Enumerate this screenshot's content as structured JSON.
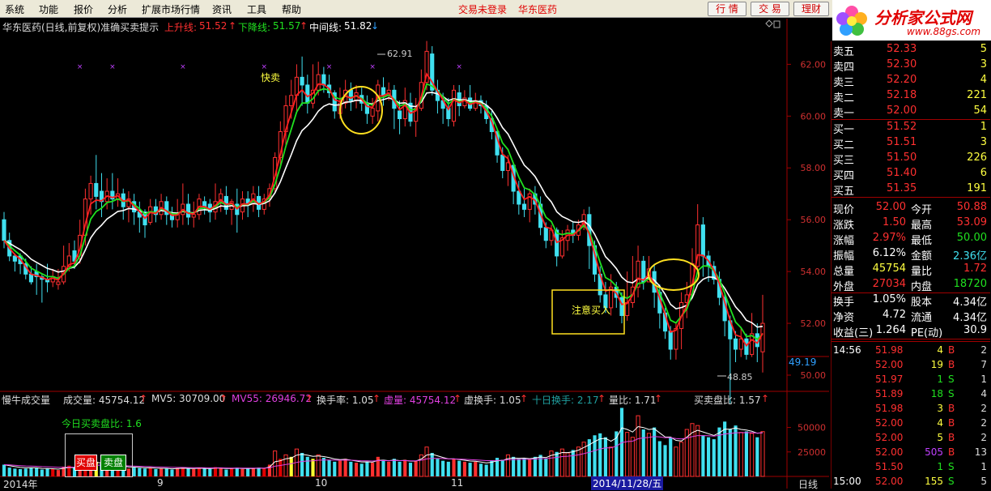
{
  "menu": {
    "items": [
      "系统",
      "功能",
      "报价",
      "分析",
      "扩展市场行情",
      "资讯",
      "工具",
      "帮助"
    ],
    "status_trade": "交易未登录",
    "status_stock": "华东医药",
    "buttons": [
      "行 情",
      "交 易",
      "理财"
    ]
  },
  "logo": {
    "text": "分析家公式网",
    "url": "www.88gs.com",
    "color": "#e00000"
  },
  "header": {
    "name": "华东医药(日线,前复权)准确买卖提示",
    "up_label": "上升线:",
    "up_value": "51.52",
    "up_arrow": "↑",
    "down_label": "下降线:",
    "down_value": "51.57",
    "down_arrow": "↑",
    "mid_label": "中间线:",
    "mid_value": "51.82",
    "mid_arrow": "↓"
  },
  "annotations": {
    "sell": "快卖",
    "buy": "注意买入",
    "high": "62.91",
    "low": "48.85"
  },
  "price_axis": {
    "ticks": [
      "62.00",
      "60.00",
      "58.00",
      "56.00",
      "54.00",
      "52.00",
      "50.00"
    ],
    "current": "49.19"
  },
  "volume_axis": {
    "ticks": [
      "50000",
      "25000"
    ]
  },
  "date_axis": {
    "labels": [
      "2014年",
      "9",
      "10",
      "11",
      "2014/11/28/五"
    ],
    "period": "日线"
  },
  "volume_header": {
    "title": "慢牛成交量",
    "vol_label": "成交量: 45754.12",
    "mv5_label": "MV5: 30709.00",
    "mv55_label": "MV55: 26946.72",
    "turnover_label": "换手率: 1.05",
    "vvol_label": "虚量: 45754.12",
    "vturn_label": "虚换手: 1.05",
    "ten_label": "十日换手: 2.17",
    "ratio_label": "量比: 1.71",
    "bs_label": "买卖盘比: 1.57",
    "arrow": "↑",
    "today_ratio": "今日买卖盘比: 1.6",
    "buy_btn": "买盘",
    "sell_btn": "卖盘"
  },
  "orderbook": {
    "sells": [
      [
        "卖五",
        "52.33",
        "5"
      ],
      [
        "卖四",
        "52.30",
        "3"
      ],
      [
        "卖三",
        "52.20",
        "4"
      ],
      [
        "卖二",
        "52.18",
        "221"
      ],
      [
        "卖一",
        "52.00",
        "54"
      ]
    ],
    "buys": [
      [
        "买一",
        "51.52",
        "1"
      ],
      [
        "买二",
        "51.51",
        "3"
      ],
      [
        "买三",
        "51.50",
        "226"
      ],
      [
        "买四",
        "51.40",
        "6"
      ],
      [
        "买五",
        "51.35",
        "191"
      ]
    ]
  },
  "stats": [
    [
      "现价",
      "52.00",
      "今开",
      "50.88"
    ],
    [
      "涨跌",
      "1.50",
      "最高",
      "53.09"
    ],
    [
      "涨幅",
      "2.97%",
      "最低",
      "50.00"
    ],
    [
      "振幅",
      "6.12%",
      "金额",
      "2.36亿"
    ],
    [
      "总量",
      "45754",
      "量比",
      "1.72"
    ],
    [
      "外盘",
      "27034",
      "内盘",
      "18720"
    ],
    [
      "换手",
      "1.05%",
      "股本",
      "4.34亿"
    ],
    [
      "净资",
      "4.72",
      "流通",
      "4.34亿"
    ],
    [
      "收益(三)",
      "1.264",
      "PE(动)",
      "30.9"
    ]
  ],
  "ticks": [
    [
      "14:56",
      "51.98",
      "4",
      "B",
      "2"
    ],
    [
      "",
      "52.00",
      "19",
      "B",
      "7"
    ],
    [
      "",
      "51.97",
      "1",
      "S",
      "1"
    ],
    [
      "",
      "51.89",
      "18",
      "S",
      "4"
    ],
    [
      "",
      "51.98",
      "3",
      "B",
      "2"
    ],
    [
      "",
      "52.00",
      "4",
      "B",
      "2"
    ],
    [
      "",
      "52.00",
      "5",
      "B",
      "2"
    ],
    [
      "",
      "52.00",
      "505",
      "B",
      "13"
    ],
    [
      "",
      "51.50",
      "1",
      "S",
      "1"
    ],
    [
      "15:00",
      "52.00",
      "155",
      "S",
      "5"
    ]
  ],
  "chart_data": {
    "type": "candlestick",
    "price_range": [
      50,
      63.2
    ],
    "volume_range": [
      0,
      72000
    ],
    "candles": [
      [
        56.0,
        55.2,
        56.3,
        54.9
      ],
      [
        55.2,
        54.6,
        55.5,
        54.4
      ],
      [
        54.6,
        54.4,
        54.7,
        54.0
      ],
      [
        54.6,
        54.3,
        54.7,
        53.9
      ],
      [
        54.3,
        53.9,
        54.5,
        53.7
      ],
      [
        53.9,
        53.6,
        54.2,
        53.5
      ],
      [
        54.0,
        53.8,
        54.3,
        53.1
      ],
      [
        53.8,
        53.7,
        53.9,
        52.8
      ],
      [
        53.7,
        53.6,
        54.3,
        53.2
      ],
      [
        53.6,
        53.8,
        54.1,
        53.4
      ],
      [
        53.5,
        53.6,
        54.1,
        53.3
      ],
      [
        53.6,
        54.2,
        55.0,
        53.5
      ],
      [
        54.2,
        54.6,
        55.1,
        54.0
      ],
      [
        54.8,
        54.4,
        55.2,
        54.1
      ],
      [
        54.5,
        55.4,
        56.0,
        54.3
      ],
      [
        55.4,
        56.8,
        57.2,
        55.0
      ],
      [
        56.8,
        57.4,
        57.7,
        56.2
      ],
      [
        57.4,
        56.9,
        58.5,
        56.4
      ],
      [
        57.1,
        56.7,
        57.8,
        56.1
      ],
      [
        56.7,
        57.1,
        57.6,
        56.4
      ],
      [
        57.1,
        56.8,
        57.8,
        56.4
      ],
      [
        56.8,
        57.0,
        57.6,
        56.5
      ],
      [
        57.0,
        56.5,
        57.2,
        56.0
      ],
      [
        56.5,
        56.8,
        57.1,
        55.9
      ],
      [
        56.7,
        56.3,
        57.0,
        55.8
      ],
      [
        56.3,
        56.1,
        56.7,
        55.5
      ],
      [
        56.3,
        55.8,
        56.4,
        55.3
      ],
      [
        55.9,
        56.5,
        56.8,
        55.8
      ],
      [
        56.5,
        56.2,
        56.8,
        55.9
      ],
      [
        56.2,
        56.7,
        57.0,
        56.0
      ],
      [
        56.7,
        56.2,
        56.9,
        55.8
      ],
      [
        56.2,
        56.0,
        56.5,
        55.7
      ],
      [
        56.0,
        56.2,
        56.8,
        55.7
      ],
      [
        56.2,
        56.6,
        57.4,
        55.8
      ],
      [
        56.6,
        56.1,
        57.0,
        55.8
      ],
      [
        56.1,
        56.2,
        56.7,
        55.7
      ],
      [
        56.2,
        56.8,
        57.0,
        56.0
      ],
      [
        56.7,
        56.5,
        56.9,
        56.2
      ],
      [
        56.6,
        56.3,
        56.8,
        55.9
      ],
      [
        56.3,
        56.7,
        57.4,
        56.0
      ],
      [
        56.7,
        57.0,
        57.2,
        56.3
      ],
      [
        56.9,
        56.4,
        57.3,
        56.2
      ],
      [
        56.4,
        56.7,
        56.8,
        55.8
      ],
      [
        56.6,
        56.2,
        57.2,
        55.5
      ],
      [
        56.3,
        56.8,
        57.1,
        56.0
      ],
      [
        56.8,
        56.6,
        57.1,
        56.1
      ],
      [
        56.6,
        57.0,
        57.3,
        56.3
      ],
      [
        56.9,
        56.4,
        57.3,
        56.1
      ],
      [
        56.4,
        56.8,
        57.0,
        56.2
      ],
      [
        56.8,
        57.2,
        57.4,
        56.5
      ],
      [
        57.2,
        58.4,
        58.6,
        57.0
      ],
      [
        58.4,
        59.4,
        59.8,
        58.0
      ],
      [
        59.4,
        60.4,
        60.8,
        58.8
      ],
      [
        60.4,
        60.8,
        61.4,
        59.9
      ],
      [
        60.8,
        61.5,
        62.0,
        60.2
      ],
      [
        61.5,
        61.2,
        62.3,
        60.4
      ],
      [
        61.2,
        60.5,
        61.6,
        60.1
      ],
      [
        60.5,
        61.0,
        62.0,
        60.3
      ],
      [
        61.0,
        61.6,
        62.1,
        60.8
      ],
      [
        61.6,
        61.2,
        61.9,
        60.9
      ],
      [
        61.2,
        60.9,
        61.6,
        60.7
      ],
      [
        60.9,
        60.2,
        61.0,
        59.9
      ],
      [
        60.1,
        60.5,
        61.1,
        59.9
      ],
      [
        60.5,
        61.0,
        61.4,
        60.3
      ],
      [
        61.0,
        60.6,
        61.3,
        60.2
      ],
      [
        60.6,
        60.9,
        61.2,
        60.3
      ],
      [
        60.8,
        60.5,
        61.1,
        60.2
      ],
      [
        60.5,
        60.1,
        60.8,
        59.7
      ],
      [
        60.0,
        60.3,
        60.7,
        59.7
      ],
      [
        60.2,
        61.2,
        61.4,
        59.8
      ],
      [
        61.1,
        60.8,
        61.5,
        60.4
      ],
      [
        60.8,
        61.0,
        61.3,
        60.6
      ],
      [
        61.0,
        60.3,
        61.2,
        59.5
      ],
      [
        60.2,
        59.9,
        60.6,
        59.3
      ],
      [
        59.9,
        60.6,
        61.1,
        59.6
      ],
      [
        60.5,
        59.8,
        60.9,
        59.6
      ],
      [
        59.8,
        60.3,
        60.7,
        59.2
      ],
      [
        60.3,
        61.3,
        61.8,
        60.2
      ],
      [
        61.3,
        62.5,
        62.9,
        61.0
      ],
      [
        62.4,
        61.0,
        62.7,
        60.8
      ],
      [
        61.0,
        60.6,
        61.4,
        60.1
      ],
      [
        60.6,
        60.3,
        60.9,
        59.7
      ],
      [
        60.3,
        59.9,
        60.7,
        59.6
      ],
      [
        59.8,
        61.0,
        61.2,
        59.6
      ],
      [
        60.9,
        60.4,
        61.2,
        60.0
      ],
      [
        60.4,
        60.7,
        61.0,
        60.3
      ],
      [
        60.7,
        60.3,
        61.2,
        60.2
      ],
      [
        60.3,
        60.6,
        60.9,
        60.2
      ],
      [
        60.6,
        60.4,
        60.8,
        60.1
      ],
      [
        60.4,
        59.9,
        60.6,
        59.7
      ],
      [
        59.9,
        59.4,
        60.2,
        59.1
      ],
      [
        59.4,
        58.5,
        59.5,
        58.2
      ],
      [
        58.5,
        57.9,
        58.8,
        57.6
      ],
      [
        57.9,
        58.2,
        58.5,
        57.3
      ],
      [
        58.1,
        57.1,
        58.2,
        56.6
      ],
      [
        57.1,
        56.6,
        57.5,
        56.2
      ],
      [
        56.6,
        56.4,
        57.2,
        56.1
      ],
      [
        56.4,
        57.0,
        57.2,
        55.9
      ],
      [
        57.0,
        56.6,
        57.3,
        56.2
      ],
      [
        56.6,
        55.7,
        56.9,
        55.4
      ],
      [
        55.7,
        55.2,
        55.9,
        54.9
      ],
      [
        55.2,
        55.6,
        55.8,
        55.0
      ],
      [
        55.6,
        54.6,
        55.7,
        54.2
      ],
      [
        54.6,
        55.3,
        55.6,
        54.5
      ],
      [
        55.2,
        55.6,
        55.8,
        54.8
      ],
      [
        55.6,
        55.4,
        55.9,
        55.1
      ],
      [
        55.4,
        55.8,
        56.0,
        55.2
      ],
      [
        55.8,
        56.2,
        56.4,
        55.6
      ],
      [
        56.2,
        55.0,
        56.5,
        54.1
      ],
      [
        55.0,
        53.9,
        55.2,
        53.6
      ],
      [
        53.9,
        53.1,
        54.2,
        52.8
      ],
      [
        53.1,
        52.6,
        53.6,
        52.4
      ],
      [
        52.6,
        53.4,
        53.9,
        52.3
      ],
      [
        53.4,
        53.0,
        53.6,
        52.6
      ],
      [
        53.0,
        52.3,
        53.2,
        52.0
      ],
      [
        52.3,
        52.8,
        54.0,
        52.1
      ],
      [
        52.8,
        53.4,
        54.6,
        52.6
      ],
      [
        53.4,
        54.4,
        55.0,
        53.0
      ],
      [
        54.4,
        53.6,
        54.6,
        53.3
      ],
      [
        53.6,
        54.1,
        54.6,
        53.7
      ],
      [
        54.0,
        53.2,
        54.3,
        52.6
      ],
      [
        53.2,
        52.4,
        53.5,
        51.8
      ],
      [
        52.4,
        51.7,
        52.6,
        51.4
      ],
      [
        51.7,
        51.0,
        51.9,
        50.6
      ],
      [
        51.0,
        51.8,
        52.0,
        50.6
      ],
      [
        51.8,
        52.8,
        53.2,
        51.0
      ],
      [
        52.8,
        53.1,
        53.6,
        52.2
      ],
      [
        53.1,
        54.3,
        54.9,
        53.0
      ],
      [
        54.2,
        55.8,
        56.6,
        54.1
      ],
      [
        55.8,
        54.6,
        56.1,
        53.8
      ],
      [
        54.6,
        54.2,
        54.8,
        53.6
      ],
      [
        54.2,
        53.7,
        54.4,
        53.5
      ],
      [
        53.7,
        53.0,
        54.0,
        52.7
      ],
      [
        53.0,
        52.1,
        53.2,
        51.5
      ],
      [
        52.1,
        51.4,
        52.3,
        48.9
      ],
      [
        51.4,
        51.0,
        51.7,
        50.5
      ],
      [
        51.0,
        51.4,
        51.8,
        50.7
      ],
      [
        51.4,
        50.8,
        51.6,
        50.6
      ],
      [
        50.8,
        51.6,
        52.4,
        50.7
      ],
      [
        51.6,
        51.1,
        52.0,
        50.5
      ],
      [
        50.9,
        52.0,
        53.1,
        50.1
      ]
    ],
    "volume": [
      12000,
      9000,
      8000,
      7500,
      8000,
      9000,
      8500,
      7000,
      8000,
      7500,
      6500,
      10000,
      11000,
      9000,
      12000,
      18000,
      16000,
      15000,
      13000,
      11000,
      10000,
      9000,
      10000,
      8000,
      9000,
      8500,
      8000,
      9000,
      7500,
      8000,
      8000,
      7000,
      8500,
      9000,
      8000,
      7500,
      9000,
      8000,
      7500,
      9500,
      8500,
      7000,
      8000,
      9000,
      7500,
      8500,
      8000,
      9000,
      8000,
      12000,
      26000,
      18000,
      22000,
      20000,
      28000,
      24000,
      20000,
      18000,
      22000,
      19000,
      17000,
      15000,
      16000,
      18000,
      15000,
      14000,
      13000,
      15000,
      14000,
      20000,
      17000,
      15000,
      18000,
      15000,
      17000,
      14000,
      16000,
      22000,
      30000,
      24000,
      18000,
      16000,
      15000,
      18000,
      16000,
      15000,
      14000,
      15000,
      13000,
      12000,
      16000,
      19000,
      17000,
      22000,
      20000,
      18000,
      19000,
      17000,
      20000,
      22000,
      18000,
      26000,
      25000,
      28000,
      24000,
      27000,
      30000,
      35000,
      38000,
      42000,
      44000,
      40000,
      30000,
      46000,
      70000,
      45000,
      40000,
      62000,
      48000,
      44000,
      50000,
      36000,
      32000,
      40000,
      30000,
      35000,
      48000,
      54000,
      52000,
      42000,
      40000,
      38000,
      50000,
      56000,
      48000,
      52000,
      45000,
      46000,
      44000,
      40000,
      45754
    ],
    "markers_x": [
      14,
      20,
      33,
      48,
      60,
      68,
      84
    ],
    "legend": {
      "up_line": "#ff2020",
      "down_line": "#20e020",
      "mid_line": "#ffffff"
    }
  }
}
